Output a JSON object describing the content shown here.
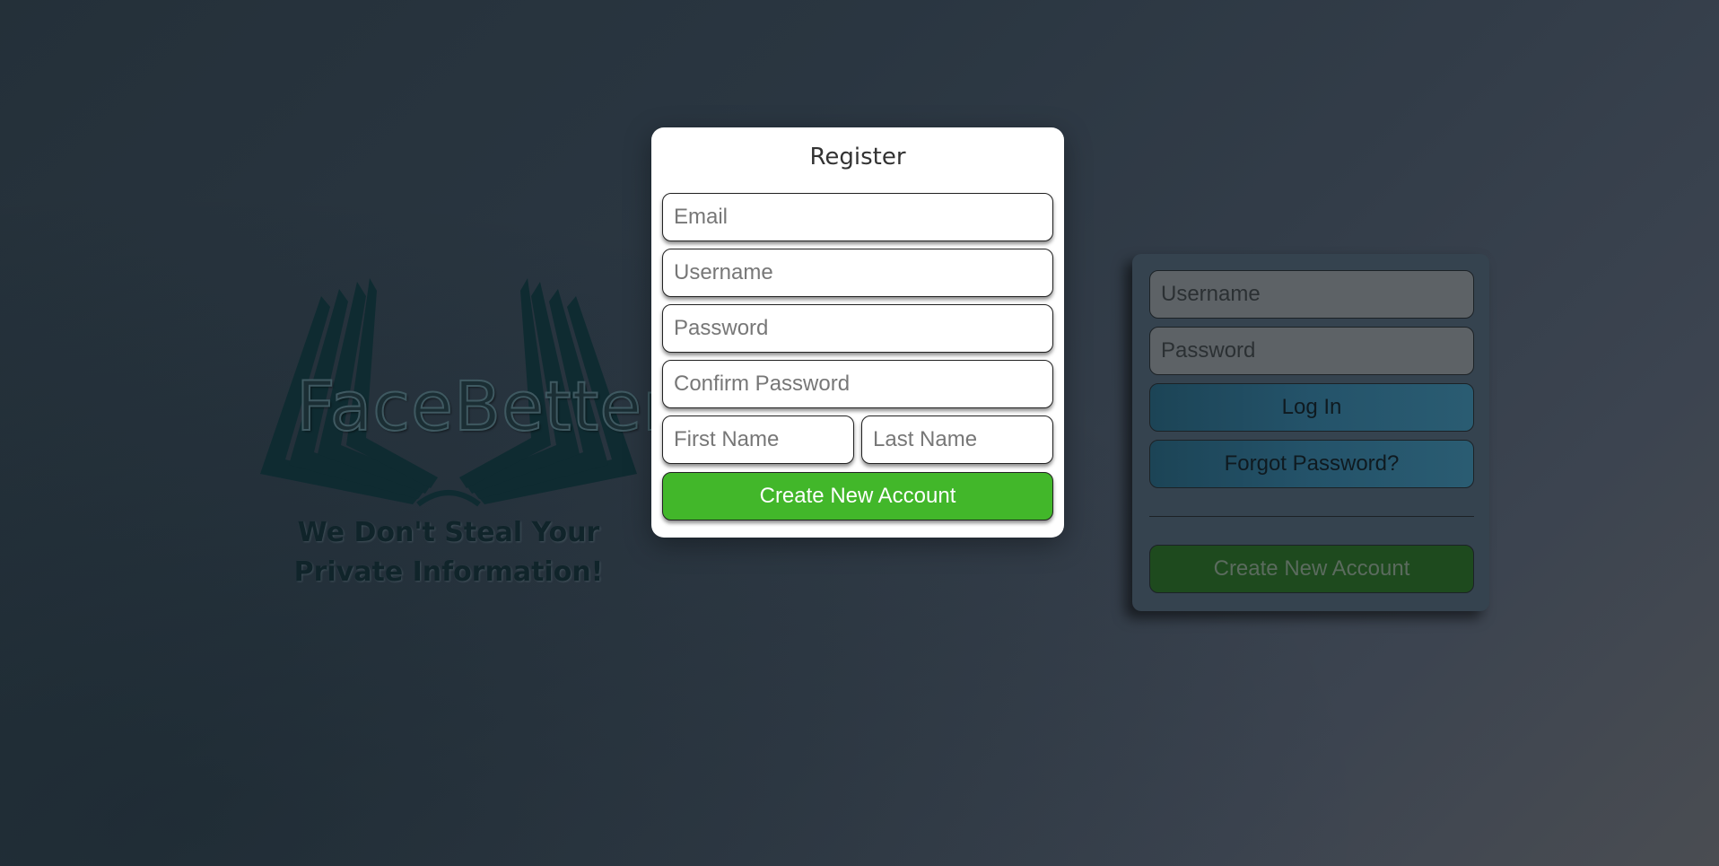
{
  "logo": {
    "icon_name": "open-book-icon",
    "brand_name": "FaceBetter",
    "tagline": "We Don't Steal Your Private Information!"
  },
  "register": {
    "title": "Register",
    "email_placeholder": "Email",
    "username_placeholder": "Username",
    "password_placeholder": "Password",
    "confirm_password_placeholder": "Confirm Password",
    "first_name_placeholder": "First Name",
    "last_name_placeholder": "Last Name",
    "submit_label": "Create New Account",
    "submit_color": "#42b72a"
  },
  "login": {
    "username_placeholder": "Username",
    "password_placeholder": "Password",
    "login_label": "Log In",
    "forgot_label": "Forgot Password?",
    "create_label": "Create New Account"
  },
  "colors": {
    "background": "#2a3641",
    "accent_green": "#42b72a",
    "accent_blue": "#1877f2"
  }
}
